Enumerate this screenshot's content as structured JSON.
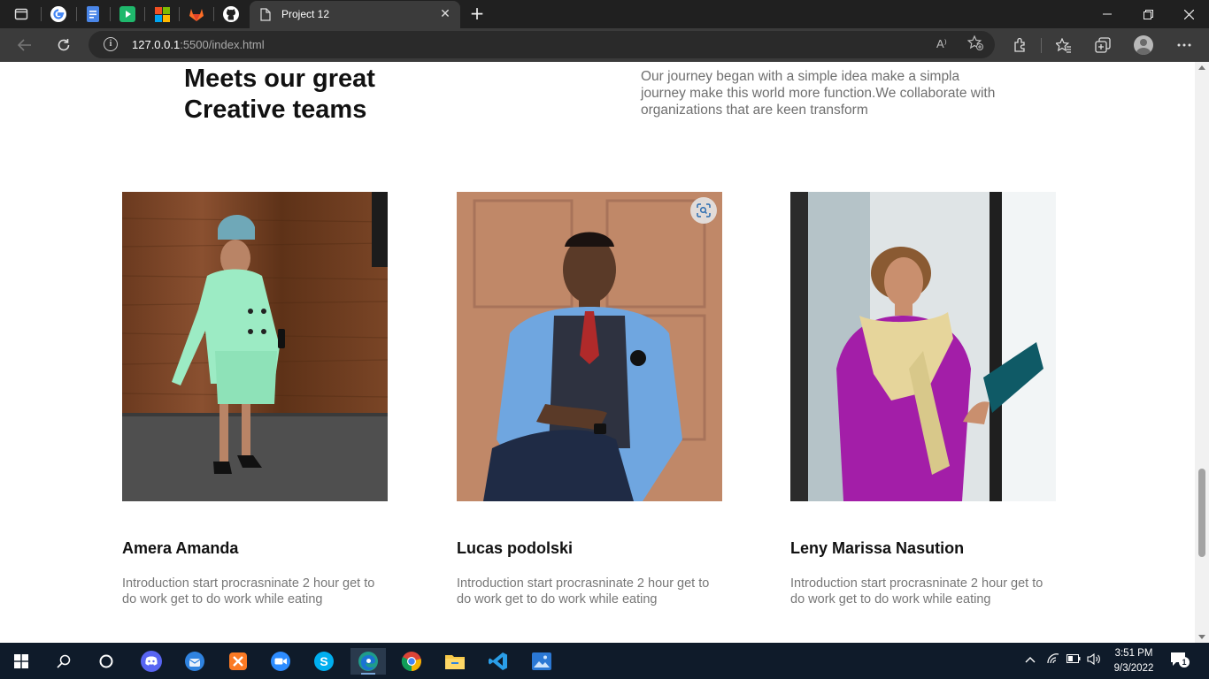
{
  "browser": {
    "active_tab_title": "Project 12",
    "url_host": "127.0.0.1",
    "url_path": ":5500/index.html",
    "read_aloud_label": "A⁾"
  },
  "page": {
    "heading": "Meets our great Creative teams",
    "description": "Our journey began with a simple idea make a simpla journey make this world more function.We collaborate with organizations that are keen transform",
    "team": [
      {
        "name": "Amera Amanda",
        "intro": "Introduction start procrasninate 2 hour get to do work get to do work while eating"
      },
      {
        "name": "Lucas podolski",
        "intro": "Introduction start procrasninate 2 hour get to do work get to do work while eating"
      },
      {
        "name": "Leny Marissa Nasution",
        "intro": "Introduction start procrasninate 2 hour get to do work get to do work while eating"
      }
    ]
  },
  "taskbar": {
    "time": "3:51 PM",
    "date": "9/3/2022",
    "notification_count": "1"
  },
  "colors": {
    "tab_strip": "#202020",
    "toolbar": "#3b3b3b",
    "taskbar": "#0f1b2a",
    "heading_text": "#111111",
    "body_text": "#777777"
  }
}
